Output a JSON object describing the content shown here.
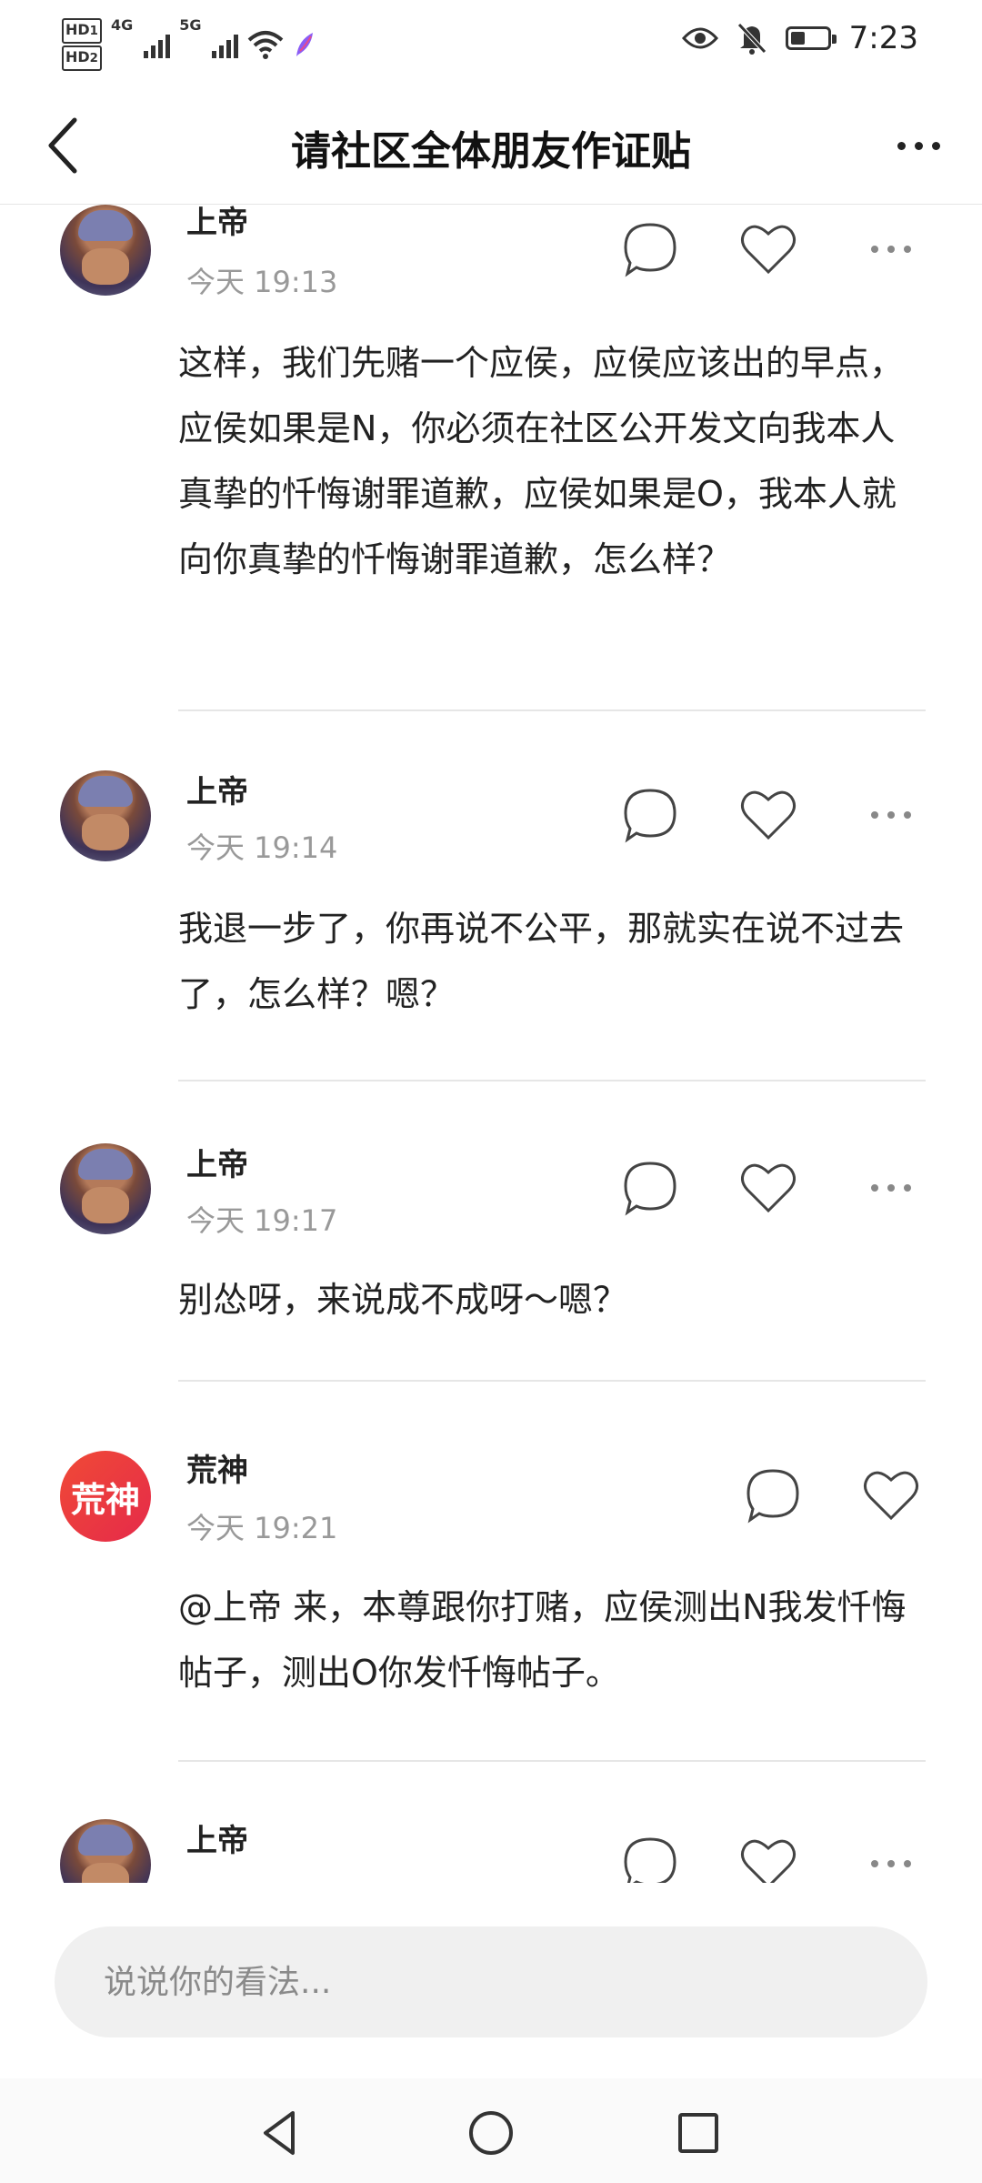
{
  "status_bar": {
    "hd1": "HD",
    "hd1_index": "1",
    "hd2": "HD",
    "hd2_index": "2",
    "net1": "4G",
    "net2": "5G",
    "time": "7:23",
    "battery_level": 0.4,
    "icons": [
      "eye-icon",
      "bell-off-icon",
      "battery-icon",
      "wifi-icon"
    ]
  },
  "header": {
    "title": "请社区全体朋友作证贴",
    "back_icon": "chevron-left-icon",
    "more_icon": "more-horizontal-icon"
  },
  "comments": [
    {
      "username": "上帝",
      "time": "今天 19:13",
      "avatar": "photo",
      "content": "这样，我们先赌一个应侯，应侯应该出的早点，应侯如果是N，你必须在社区公开发文向我本人真挚的忏悔谢罪道歉，应侯如果是O，我本人就向你真挚的忏悔谢罪道歉，怎么样？"
    },
    {
      "username": "上帝",
      "time": "今天 19:14",
      "avatar": "photo",
      "content": "我退一步了，你再说不公平，那就实在说不过去了，怎么样？嗯？"
    },
    {
      "username": "上帝",
      "time": "今天 19:17",
      "avatar": "photo",
      "content": "别怂呀，来说成不成呀～嗯？"
    },
    {
      "username": "荒神",
      "time": "今天 19:21",
      "avatar_text": "荒神",
      "content": "@上帝 来，本尊跟你打赌，应侯测出N我发忏悔帖子，测出O你发忏悔帖子。"
    },
    {
      "username": "上帝",
      "avatar": "photo"
    }
  ],
  "input": {
    "placeholder": "说说你的看法..."
  },
  "nav": {
    "icons": [
      "back-triangle-icon",
      "home-circle-icon",
      "recents-square-icon"
    ]
  }
}
